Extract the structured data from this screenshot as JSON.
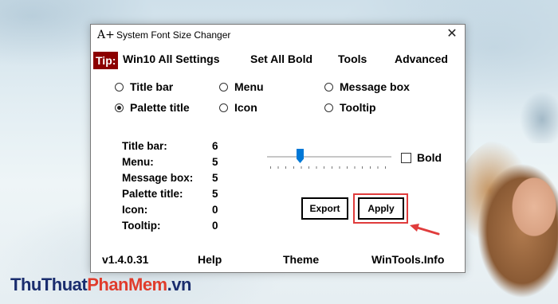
{
  "window": {
    "app_icon": "A+",
    "title": "System Font Size Changer",
    "close_glyph": "✕"
  },
  "menu": {
    "tip": "Tip:",
    "items": [
      "Win10 All Settings",
      "Set All Bold",
      "Tools",
      "Advanced"
    ]
  },
  "options": [
    {
      "label": "Title bar",
      "checked": false
    },
    {
      "label": "Menu",
      "checked": false
    },
    {
      "label": "Message box",
      "checked": false
    },
    {
      "label": "Palette title",
      "checked": true
    },
    {
      "label": "Icon",
      "checked": false
    },
    {
      "label": "Tooltip",
      "checked": false
    }
  ],
  "stats": [
    {
      "label": "Title bar:",
      "value": "6"
    },
    {
      "label": "Menu:",
      "value": "5"
    },
    {
      "label": "Message box:",
      "value": "5"
    },
    {
      "label": "Palette title:",
      "value": "5"
    },
    {
      "label": "Icon:",
      "value": "0"
    },
    {
      "label": "Tooltip:",
      "value": "0"
    }
  ],
  "slider": {
    "value_fraction": 0.25
  },
  "bold_checkbox": {
    "label": "Bold",
    "checked": false
  },
  "buttons": {
    "export": "Export",
    "apply": "Apply"
  },
  "footer": {
    "version": "v1.4.0.31",
    "help": "Help",
    "theme": "Theme",
    "site": "WinTools.Info"
  },
  "watermark": {
    "part1": "ThuThuat",
    "part2": "PhanMem",
    "part3": ".vn"
  },
  "colors": {
    "tip_bg": "#8c0000",
    "highlight": "#e03c3c",
    "slider_thumb": "#0078d7"
  }
}
